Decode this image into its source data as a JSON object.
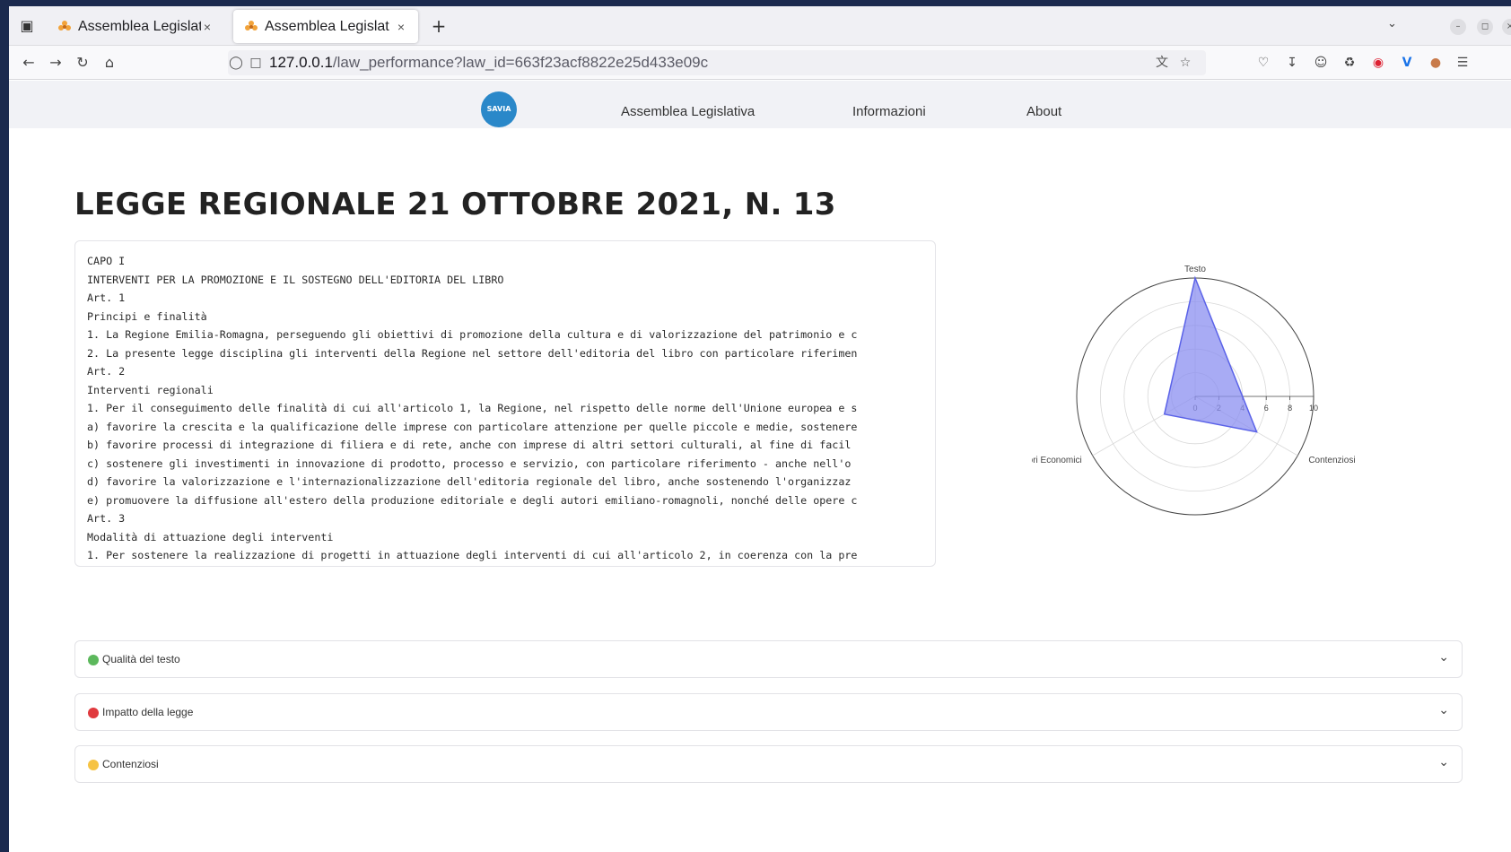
{
  "browser": {
    "tabs": [
      {
        "title": "Assemblea Legislat",
        "active": false
      },
      {
        "title": "Assemblea Legislat",
        "active": true
      }
    ],
    "url_host": "127.0.0.1",
    "url_path": "/law_performance?law_id=663f23acf8822e25d433e09c"
  },
  "site": {
    "logo_text": "SAVIA",
    "menu": [
      "Assemblea Legislativa",
      "Informazioni",
      "About"
    ]
  },
  "law": {
    "title": "LEGGE REGIONALE 21 OTTOBRE 2021, N. 13",
    "lines": [
      "CAPO I",
      "INTERVENTI PER LA PROMOZIONE E IL SOSTEGNO DELL'EDITORIA DEL LIBRO",
      "Art. 1",
      "Principi e finalità",
      "1. La Regione Emilia-Romagna, perseguendo gli obiettivi di promozione della cultura e di valorizzazione del patrimonio e c",
      "2. La presente legge disciplina gli interventi della Regione nel settore dell'editoria del libro con particolare riferimen",
      "Art. 2",
      "Interventi regionali",
      "1. Per il conseguimento delle finalità di cui all'articolo 1, la Regione, nel rispetto delle norme dell'Unione europea e s",
      "a) favorire la crescita e la qualificazione delle imprese con particolare attenzione per quelle piccole e medie, sostenere",
      "b) favorire processi di integrazione di filiera e di rete, anche con imprese di altri settori culturali, al fine di facil",
      "c) sostenere gli investimenti in innovazione di prodotto, processo e servizio, con particolare riferimento - anche nell'o",
      "d) favorire la valorizzazione e l'internazionalizzazione dell'editoria regionale del libro, anche sostenendo l'organizzaz",
      "e) promuovere la diffusione all'estero della produzione editoriale e degli autori emiliano-romagnoli, nonché delle opere c",
      "Art. 3",
      "Modalità di attuazione degli interventi",
      "1. Per sostenere la realizzazione di progetti in attuazione degli interventi di cui all'articolo 2, in coerenza con la pre"
    ]
  },
  "expanders": [
    {
      "label": "Qualità del testo",
      "color": "#5cb85c"
    },
    {
      "label": "Impatto della legge",
      "color": "#e03a3e"
    },
    {
      "label": "Contenziosi",
      "color": "#f6c343"
    }
  ],
  "chart_data": {
    "type": "radar",
    "axes": [
      "Testo",
      "Contenziosi",
      "Indicatori Economici"
    ],
    "values": [
      10,
      6,
      3
    ],
    "range": [
      0,
      10
    ],
    "tick_labels": [
      "0",
      "2",
      "4",
      "6",
      "8",
      "10"
    ],
    "fill_color": "#8b8ff0",
    "line_color": "#5a62e8"
  }
}
